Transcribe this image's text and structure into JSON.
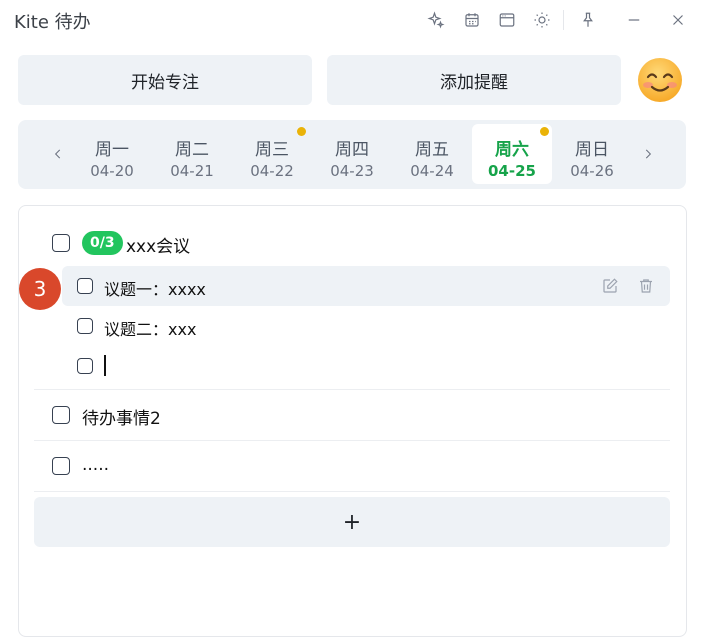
{
  "app": {
    "title": "Kite 待办"
  },
  "header": {
    "start_focus_label": "开始专注",
    "add_reminder_label": "添加提醒"
  },
  "week": {
    "days": [
      {
        "name": "周一",
        "date": "04-20",
        "dot": false,
        "active": false
      },
      {
        "name": "周二",
        "date": "04-21",
        "dot": false,
        "active": false
      },
      {
        "name": "周三",
        "date": "04-22",
        "dot": true,
        "active": false
      },
      {
        "name": "周四",
        "date": "04-23",
        "dot": false,
        "active": false
      },
      {
        "name": "周五",
        "date": "04-24",
        "dot": false,
        "active": false
      },
      {
        "name": "周六",
        "date": "04-25",
        "dot": true,
        "active": true
      },
      {
        "name": "周日",
        "date": "04-26",
        "dot": false,
        "active": false
      }
    ]
  },
  "tasks": {
    "task1": {
      "progress": "0/3",
      "title": "xxx会议",
      "subtasks": [
        "议题一：xxxx",
        "议题二：xxx"
      ],
      "new_subtask_value": ""
    },
    "task2": {
      "title": "待办事情2"
    },
    "task3": {
      "title": "....."
    },
    "add_label": "+"
  },
  "overlay": {
    "step_number": "3"
  },
  "colors": {
    "accent": "#16a34a",
    "badge": "#22c55e",
    "dot": "#eab308",
    "step_marker": "#d9482b",
    "surface": "#eef2f6"
  }
}
